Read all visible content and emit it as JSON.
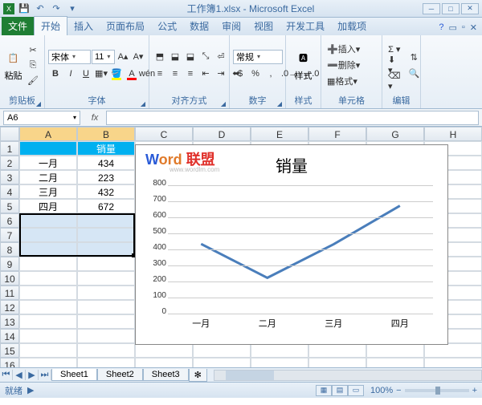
{
  "window": {
    "title": "工作簿1.xlsx - Microsoft Excel",
    "qat": {
      "save": "💾",
      "undo": "↶",
      "redo": "↷"
    }
  },
  "tabs": {
    "file": "文件",
    "home": "开始",
    "insert": "插入",
    "layout": "页面布局",
    "formulas": "公式",
    "data": "数据",
    "review": "审阅",
    "view": "视图",
    "dev": "开发工具",
    "addin": "加载项"
  },
  "ribbon": {
    "clipboard": {
      "label": "剪贴板",
      "paste": "粘贴"
    },
    "font": {
      "label": "字体",
      "name": "宋体",
      "size": "11",
      "bold": "B",
      "italic": "I",
      "underline": "U"
    },
    "align": {
      "label": "对齐方式"
    },
    "number": {
      "label": "数字",
      "format": "常规"
    },
    "styles": {
      "label": "样式",
      "btn": "样式"
    },
    "cells": {
      "label": "单元格",
      "insert": "插入",
      "delete": "删除",
      "format": "格式"
    },
    "editing": {
      "label": "编辑"
    }
  },
  "namebox": "A6",
  "columns": [
    "A",
    "B",
    "C",
    "D",
    "E",
    "F",
    "G",
    "H"
  ],
  "rows_count": 17,
  "data_cells": {
    "B1": "销量",
    "A2": "一月",
    "B2": "434",
    "A3": "二月",
    "B3": "223",
    "A4": "三月",
    "B4": "432",
    "A5": "四月",
    "B5": "672"
  },
  "chart_data": {
    "type": "line",
    "title": "销量",
    "categories": [
      "一月",
      "二月",
      "三月",
      "四月"
    ],
    "values": [
      434,
      223,
      432,
      672
    ],
    "ylim": [
      0,
      800
    ],
    "ytick": 100,
    "xlabel": "",
    "ylabel": ""
  },
  "watermark": {
    "text_w": "W",
    "text_ord": "ord",
    "text_lm": "联盟",
    "url": "www.wordlm.com"
  },
  "sheets": {
    "s1": "Sheet1",
    "s2": "Sheet2",
    "s3": "Sheet3"
  },
  "status": {
    "ready": "就绪",
    "zoom": "100%"
  }
}
